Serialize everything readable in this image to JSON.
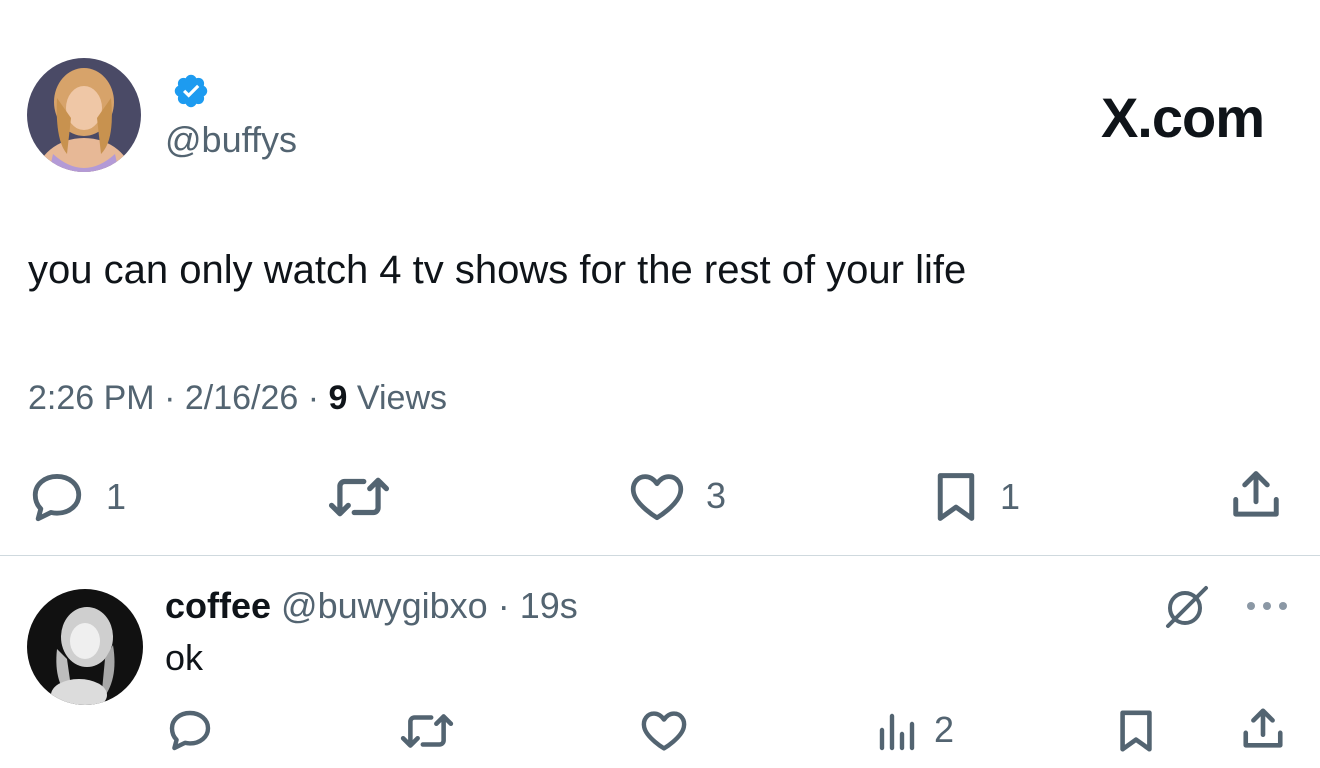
{
  "main_tweet": {
    "handle": "@buffys",
    "verified": true,
    "brand": "X.com",
    "text": "you can only watch 4 tv shows for the rest of your life",
    "time": "2:26 PM",
    "separator": "·",
    "date": "2/16/26",
    "views_count": "9",
    "views_label": "Views",
    "actions": {
      "reply": {
        "icon": "reply-icon",
        "count": "1"
      },
      "retweet": {
        "icon": "retweet-icon",
        "count": ""
      },
      "like": {
        "icon": "heart-icon",
        "count": "3"
      },
      "bookmark": {
        "icon": "bookmark-icon",
        "count": "1"
      },
      "share": {
        "icon": "share-icon"
      }
    }
  },
  "reply": {
    "display_name": "coffee",
    "handle": "@buwygibxo",
    "separator": "·",
    "time": "19s",
    "text": "ok",
    "actions": {
      "reply": {
        "icon": "reply-icon"
      },
      "retweet": {
        "icon": "retweet-icon"
      },
      "like": {
        "icon": "heart-icon"
      },
      "views": {
        "icon": "analytics-icon",
        "count": "2"
      },
      "bookmark": {
        "icon": "bookmark-icon"
      },
      "share": {
        "icon": "share-icon"
      }
    }
  },
  "colors": {
    "text_primary": "#0f1419",
    "text_secondary": "#536471",
    "verified_blue": "#1d9bf0",
    "divider": "#cfd9de"
  }
}
